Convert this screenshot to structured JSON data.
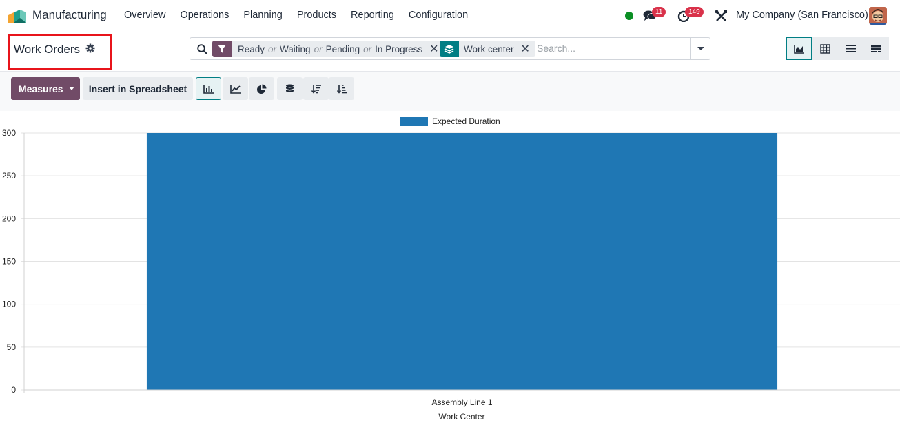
{
  "app": {
    "name": "Manufacturing",
    "menu": [
      "Overview",
      "Operations",
      "Planning",
      "Products",
      "Reporting",
      "Configuration"
    ],
    "messages_badge": "11",
    "activities_badge": "149",
    "company": "My Company (San Francisco)"
  },
  "control_panel": {
    "title": "Work Orders",
    "search": {
      "facet_filter": {
        "values": [
          "Ready",
          "Waiting",
          "Pending",
          "In Progress"
        ],
        "separator": "or"
      },
      "facet_groupby": {
        "label": "Work center"
      },
      "placeholder": "Search..."
    },
    "views": [
      "graph-view",
      "pivot-view",
      "list-view",
      "kanban-view"
    ]
  },
  "toolbar": {
    "measures_label": "Measures",
    "spreadsheet_label": "Insert in Spreadsheet"
  },
  "colors": {
    "brand": "#714b67",
    "accent": "#017e84",
    "bar": "#1f77b4"
  },
  "chart_data": {
    "type": "bar",
    "categories": [
      "Assembly Line 1"
    ],
    "series": [
      {
        "name": "Expected Duration",
        "values": [
          300
        ]
      }
    ],
    "xlabel": "Work Center",
    "ylabel": "",
    "ylim": [
      0,
      300
    ],
    "yticks": [
      0,
      50,
      100,
      150,
      200,
      250,
      300
    ],
    "legend_position": "top-center",
    "grid": true
  }
}
